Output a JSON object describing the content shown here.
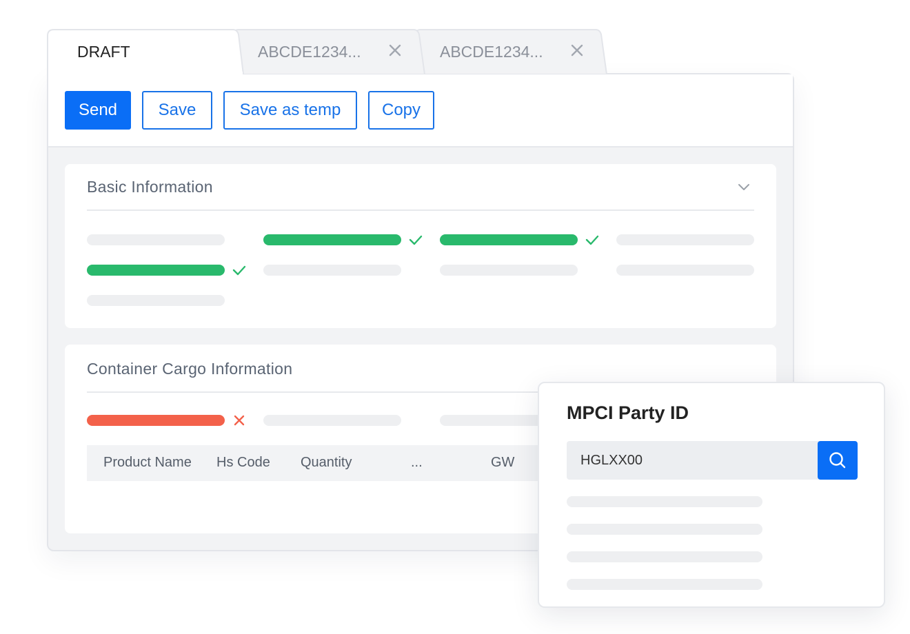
{
  "tabs": [
    {
      "label": "DRAFT",
      "active": true,
      "closable": false
    },
    {
      "label": "ABCDE1234...",
      "active": false,
      "closable": true
    },
    {
      "label": "ABCDE1234...",
      "active": false,
      "closable": true
    }
  ],
  "toolbar": {
    "send_label": "Send",
    "save_label": "Save",
    "save_temp_label": "Save as temp",
    "copy_label": "Copy"
  },
  "basic_info": {
    "title": "Basic Information",
    "collapse_icon": "chevron-down-icon"
  },
  "container_cargo": {
    "title": "Container Cargo Information",
    "columns": [
      "Product Name",
      "Hs Code",
      "Quantity",
      "...",
      "GW"
    ]
  },
  "party_popup": {
    "title": "MPCI Party ID",
    "search_value": "HGLXX00",
    "search_icon": "search-icon"
  },
  "colors": {
    "primary": "#0a6ef6",
    "success": "#29b96c",
    "error": "#f3614a"
  }
}
